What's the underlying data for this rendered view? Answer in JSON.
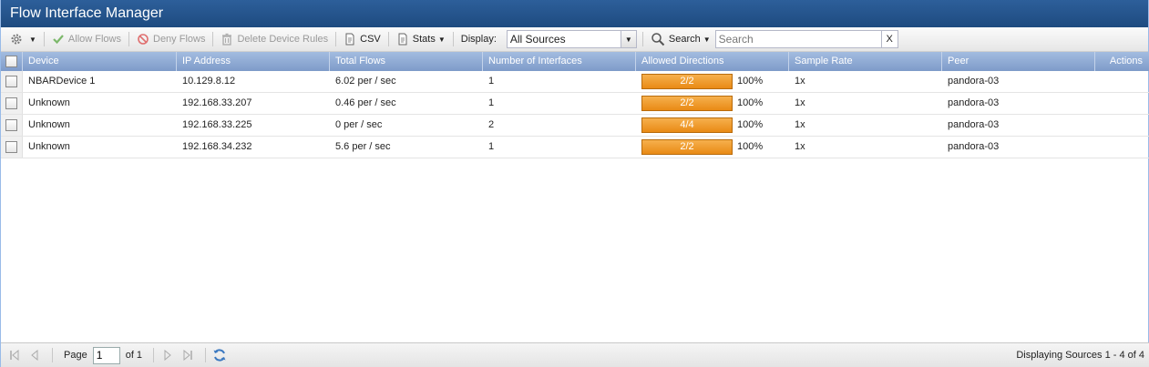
{
  "window": {
    "title": "Flow Interface Manager"
  },
  "toolbar": {
    "gear_icon": "gear-icon",
    "allow_label": "Allow Flows",
    "deny_label": "Deny Flows",
    "delete_label": "Delete Device Rules",
    "csv_label": "CSV",
    "stats_label": "Stats",
    "display_label": "Display:",
    "display_value": "All Sources",
    "search_button_label": "Search",
    "search_placeholder": "Search",
    "clear_label": "X"
  },
  "grid": {
    "columns": [
      "Device",
      "IP Address",
      "Total Flows",
      "Number of Interfaces",
      "Allowed Directions",
      "Sample Rate",
      "Peer",
      "Actions"
    ],
    "rows": [
      {
        "device": "NBARDevice 1",
        "ip": "10.129.8.12",
        "flows": "6.02 per / sec",
        "interfaces": "1",
        "directions": "2/2",
        "directions_pct": "100%",
        "directions_fill": 1.0,
        "rate": "1x",
        "peer": "pandora-03"
      },
      {
        "device": "Unknown",
        "ip": "192.168.33.207",
        "flows": "0.46 per / sec",
        "interfaces": "1",
        "directions": "2/2",
        "directions_pct": "100%",
        "directions_fill": 1.0,
        "rate": "1x",
        "peer": "pandora-03"
      },
      {
        "device": "Unknown",
        "ip": "192.168.33.225",
        "flows": "0 per / sec",
        "interfaces": "2",
        "directions": "4/4",
        "directions_pct": "100%",
        "directions_fill": 1.0,
        "rate": "1x",
        "peer": "pandora-03"
      },
      {
        "device": "Unknown",
        "ip": "192.168.34.232",
        "flows": "5.6 per / sec",
        "interfaces": "1",
        "directions": "2/2",
        "directions_pct": "100%",
        "directions_fill": 1.0,
        "rate": "1x",
        "peer": "pandora-03"
      }
    ]
  },
  "paging": {
    "page_label": "Page",
    "page_value": "1",
    "of_label": "of 1",
    "display_info": "Displaying Sources 1 - 4 of 4"
  },
  "colors": {
    "title_bar": "#1e4b80",
    "header": "#8fabd6",
    "direction_bar": "#ee9a2a"
  }
}
